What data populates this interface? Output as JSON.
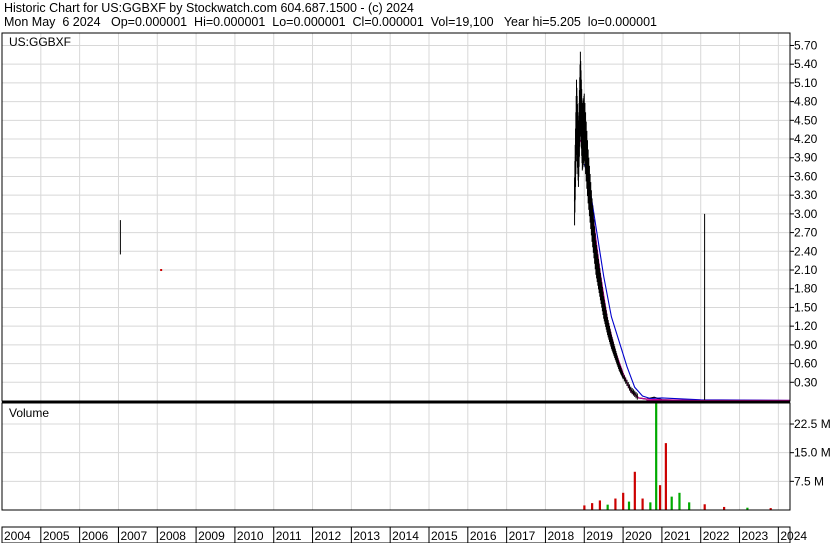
{
  "header": {
    "line1": "Historic Chart for US:GGBXF by Stockwatch.com 604.687.1500 - (c) 2024",
    "line2": "Mon May  6 2024   Op=0.000001  Hi=0.000001  Lo=0.000001  Cl=0.000001  Vol=19,100   Year hi=5.205  lo=0.000001"
  },
  "chart_data": [
    {
      "type": "line",
      "title": "US:GGBXF",
      "ylim": [
        0,
        5.9
      ],
      "y_ticks": [
        "0.30",
        "0.60",
        "0.90",
        "1.20",
        "1.50",
        "1.80",
        "2.10",
        "2.40",
        "2.70",
        "3.00",
        "3.30",
        "3.60",
        "3.90",
        "4.20",
        "4.50",
        "4.80",
        "5.10",
        "5.40",
        "5.70"
      ],
      "series": [
        {
          "color": "#000000",
          "x": [
            2018.75,
            2018.8,
            2018.85,
            2018.9,
            2018.95,
            2019.0,
            2019.1,
            2019.2,
            2019.3,
            2019.4,
            2019.5,
            2019.6,
            2019.7,
            2019.8,
            2019.9,
            2020.0,
            2020.2,
            2020.4,
            2020.6,
            2020.8,
            2021.0,
            2021.5,
            2022.0,
            2022.5,
            2023.0,
            2024.3
          ],
          "y": [
            3.2,
            4.6,
            3.9,
            5.0,
            4.2,
            4.4,
            3.6,
            2.9,
            2.3,
            1.9,
            1.5,
            1.2,
            0.95,
            0.75,
            0.55,
            0.4,
            0.18,
            0.05,
            0.03,
            0.06,
            0.02,
            0.01,
            0.01,
            0.005,
            0.003,
            1e-06
          ]
        },
        {
          "color": "#cc0099",
          "x": [
            2018.85,
            2019.0,
            2019.2,
            2019.4,
            2019.6,
            2019.8,
            2020.0,
            2020.2,
            2020.4,
            2020.6,
            2021.0,
            2022.0,
            2024.3
          ],
          "y": [
            4.2,
            4.1,
            3.1,
            2.1,
            1.3,
            0.8,
            0.45,
            0.15,
            0.05,
            0.03,
            0.02,
            0.01,
            0.01
          ]
        },
        {
          "color": "#0000cc",
          "x": [
            2019.0,
            2019.1,
            2019.3,
            2019.5,
            2019.7,
            2019.9,
            2020.1,
            2020.3,
            2020.5,
            2020.7,
            2021.0,
            2022.0,
            2024.3
          ],
          "y": [
            3.8,
            3.6,
            2.8,
            2.0,
            1.35,
            0.95,
            0.55,
            0.22,
            0.08,
            0.04,
            0.05,
            0.02,
            0.01
          ]
        }
      ],
      "spikes": [
        {
          "x": 2007.05,
          "high": 2.9,
          "low": 2.35
        },
        {
          "x": 2022.1,
          "high": 3.0,
          "low": 0.0
        }
      ],
      "dots": [
        {
          "x": 2008.1,
          "y": 2.1,
          "color": "#cc0000"
        }
      ]
    },
    {
      "type": "bar",
      "title": "Volume",
      "ylim": [
        0,
        28
      ],
      "y_ticks": [
        "7.5 M",
        "15.0 M",
        "22.5 M"
      ],
      "bars": [
        {
          "x": 2019.0,
          "value": 1.2,
          "color": "#cc0000"
        },
        {
          "x": 2019.2,
          "value": 1.8,
          "color": "#cc0000"
        },
        {
          "x": 2019.4,
          "value": 2.5,
          "color": "#cc0000"
        },
        {
          "x": 2019.6,
          "value": 1.4,
          "color": "#00aa00"
        },
        {
          "x": 2019.8,
          "value": 3.0,
          "color": "#cc0000"
        },
        {
          "x": 2020.0,
          "value": 4.5,
          "color": "#cc0000"
        },
        {
          "x": 2020.15,
          "value": 2.2,
          "color": "#00aa00"
        },
        {
          "x": 2020.3,
          "value": 10.0,
          "color": "#cc0000"
        },
        {
          "x": 2020.5,
          "value": 3.0,
          "color": "#cc0000"
        },
        {
          "x": 2020.7,
          "value": 2.0,
          "color": "#00aa00"
        },
        {
          "x": 2020.85,
          "value": 35.0,
          "color": "#00aa00"
        },
        {
          "x": 2020.95,
          "value": 6.5,
          "color": "#cc0000"
        },
        {
          "x": 2021.1,
          "value": 17.5,
          "color": "#cc0000"
        },
        {
          "x": 2021.25,
          "value": 3.5,
          "color": "#00aa00"
        },
        {
          "x": 2021.45,
          "value": 4.5,
          "color": "#00aa00"
        },
        {
          "x": 2021.7,
          "value": 2.0,
          "color": "#00aa00"
        },
        {
          "x": 2022.1,
          "value": 1.5,
          "color": "#cc0000"
        },
        {
          "x": 2022.6,
          "value": 0.8,
          "color": "#cc0000"
        },
        {
          "x": 2023.2,
          "value": 0.6,
          "color": "#00aa00"
        },
        {
          "x": 2023.8,
          "value": 0.5,
          "color": "#cc0000"
        }
      ]
    }
  ],
  "x_axis": {
    "range": [
      2004,
      2024.3
    ],
    "labels": [
      "2004",
      "2005",
      "2006",
      "2007",
      "2008",
      "2009",
      "2010",
      "2011",
      "2012",
      "2013",
      "2014",
      "2015",
      "2016",
      "2017",
      "2018",
      "2019",
      "2020",
      "2021",
      "2022",
      "2023",
      "2024"
    ]
  }
}
